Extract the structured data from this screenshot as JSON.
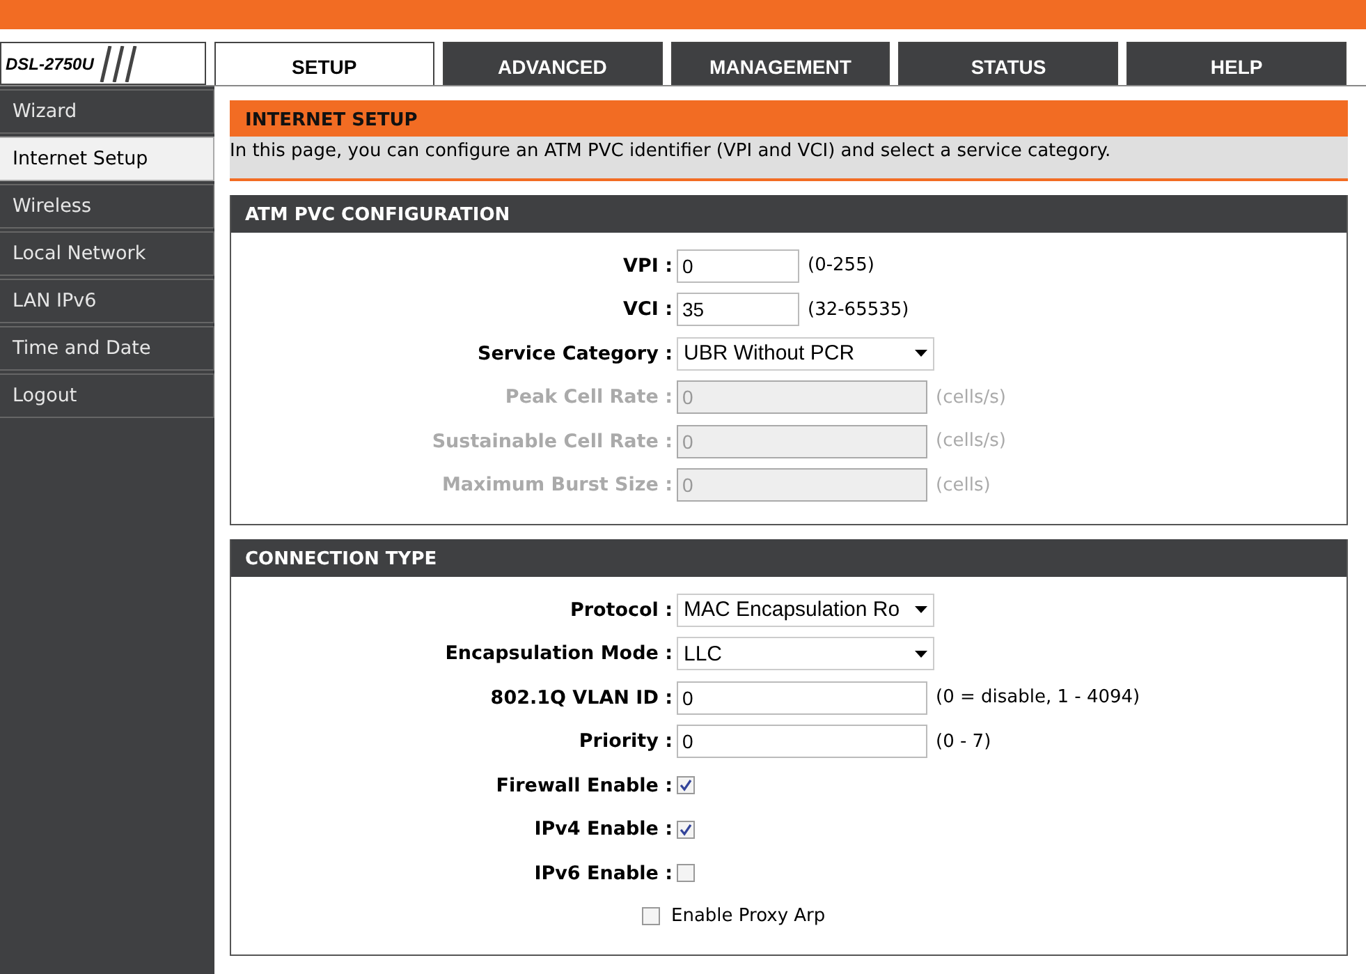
{
  "logo": {
    "model": "DSL-2750U"
  },
  "tabs": [
    {
      "label": "SETUP",
      "selected": true
    },
    {
      "label": "ADVANCED",
      "selected": false
    },
    {
      "label": "MANAGEMENT",
      "selected": false
    },
    {
      "label": "STATUS",
      "selected": false
    },
    {
      "label": "HELP",
      "selected": false
    }
  ],
  "sidebar": {
    "items": [
      {
        "label": "Wizard",
        "selected": false
      },
      {
        "label": "Internet Setup",
        "selected": true
      },
      {
        "label": "Wireless",
        "selected": false
      },
      {
        "label": "Local Network",
        "selected": false
      },
      {
        "label": "LAN IPv6",
        "selected": false
      },
      {
        "label": "Time and Date",
        "selected": false
      },
      {
        "label": "Logout",
        "selected": false
      }
    ]
  },
  "intro": {
    "title": "INTERNET SETUP",
    "description": "In this page, you can configure an ATM PVC identifier (VPI and VCI) and select a service category."
  },
  "sections": [
    {
      "title": "ATM PVC CONFIGURATION",
      "rows": [
        {
          "kind": "short",
          "label": "VPI :",
          "value": "0",
          "hint": "(0-255)",
          "disabled": false
        },
        {
          "kind": "short",
          "label": "VCI :",
          "value": "35",
          "hint": "(32-65535)",
          "disabled": false
        },
        {
          "kind": "select",
          "label": "Service Category :",
          "value": "UBR Without PCR",
          "disabled": false
        },
        {
          "kind": "text",
          "label": "Peak Cell Rate :",
          "value": "0",
          "hint": "(cells/s)",
          "disabled": true
        },
        {
          "kind": "text",
          "label": "Sustainable Cell Rate :",
          "value": "0",
          "hint": "(cells/s)",
          "disabled": true
        },
        {
          "kind": "text",
          "label": "Maximum Burst Size :",
          "value": "0",
          "hint": "(cells)",
          "disabled": true
        }
      ]
    },
    {
      "title": "CONNECTION TYPE",
      "rows": [
        {
          "kind": "select",
          "label": "Protocol :",
          "value": "MAC Encapsulation Ro",
          "disabled": false
        },
        {
          "kind": "select",
          "label": "Encapsulation Mode :",
          "value": "LLC",
          "disabled": false
        },
        {
          "kind": "text",
          "label": "802.1Q VLAN ID :",
          "value": "0",
          "hint": "(0 = disable, 1 - 4094)",
          "disabled": false
        },
        {
          "kind": "text",
          "label": "Priority :",
          "value": "0",
          "hint": "(0 - 7)",
          "disabled": false
        },
        {
          "kind": "checkbox",
          "label": "Firewall Enable :",
          "checked": true
        },
        {
          "kind": "checkbox",
          "label": "IPv4 Enable :",
          "checked": true
        },
        {
          "kind": "checkbox",
          "label": "IPv6 Enable :",
          "checked": false
        },
        {
          "kind": "inline-checkbox",
          "label": "Enable Proxy Arp",
          "checked": false
        }
      ]
    }
  ]
}
